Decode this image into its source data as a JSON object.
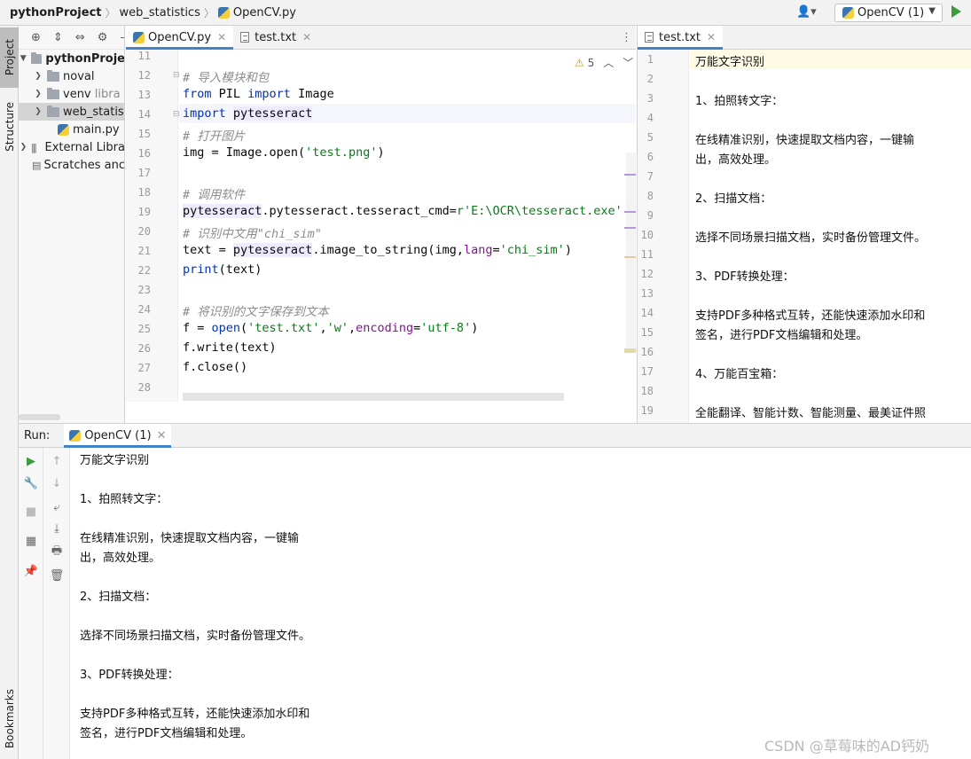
{
  "breadcrumb": {
    "project": "pythonProject",
    "folder": "web_statistics",
    "file": "OpenCV.py"
  },
  "toolbar": {
    "run_config": "OpenCV (1)"
  },
  "side_tabs": {
    "project": "Project",
    "structure": "Structure",
    "bookmarks": "Bookmarks"
  },
  "project_tree": {
    "root": "pythonProje",
    "items": [
      "noval",
      "venv",
      "libra",
      "web_statis",
      "main.py",
      "External Libra",
      "Scratches anc"
    ]
  },
  "editor_tabs": {
    "main": "OpenCV.py",
    "secondary": "test.txt",
    "right": "test.txt"
  },
  "inspection": {
    "warning_count": "5"
  },
  "code": {
    "line_numbers": [
      "11",
      "12",
      "13",
      "14",
      "15",
      "16",
      "17",
      "18",
      "19",
      "20",
      "21",
      "22",
      "23",
      "24",
      "25",
      "26",
      "27",
      "28"
    ],
    "c12": "# 导入模块和包",
    "l13a": "from",
    "l13b": " PIL ",
    "l13c": "import",
    "l13d": " Image",
    "l14a": "import",
    "l14b": "pytesseract",
    "c15": "# 打开图片",
    "l16a": "img = Image.open(",
    "l16b": "'test.png'",
    "l16c": ")",
    "c18": "# 调用软件",
    "l19a": "pytesseract",
    "l19b": ".pytesseract.tesseract_cmd=",
    "l19c": "r'E:\\OCR\\tesseract.exe'",
    "c20": "# 识别中文用\"chi_sim\"",
    "l21a": "text = ",
    "l21b": "pytesseract",
    "l21c": ".image_to_string(img,",
    "l21d": "lang",
    "l21e": "=",
    "l21f": "'chi_sim'",
    "l21g": ")",
    "l22a": "print",
    "l22b": "(text)",
    "c24": "# 将识别的文字保存到文本",
    "l25a": "f = ",
    "l25b": "open",
    "l25c": "(",
    "l25d": "'test.txt'",
    "l25e": ",",
    "l25f": "'w'",
    "l25g": ",",
    "l25h": "encoding",
    "l25i": "=",
    "l25j": "'utf-8'",
    "l25k": ")",
    "l26": "f.write(text)",
    "l27": "f.close()"
  },
  "text_file": {
    "line_numbers": [
      "1",
      "2",
      "3",
      "4",
      "5",
      "6",
      "7",
      "8",
      "9",
      "10",
      "11",
      "12",
      "13",
      "14",
      "15",
      "16",
      "17",
      "18",
      "19"
    ],
    "lines": [
      "万能文字识别",
      "",
      "1、拍照转文字：",
      "",
      "在线精准识别，快速提取文档内容，一键输",
      "出，高效处理。",
      "",
      "2、扫描文档：",
      "",
      "选择不同场景扫描文档，实时备份管理文件。",
      "",
      "3、PDF转换处理：",
      "",
      "支持PDF多种格式互转，还能快速添加水印和",
      "签名，进行PDF文档编辑和处理。",
      "",
      "4、万能百宝箱：",
      "",
      "全能翻译、智能计数、智能测量、最美证件照"
    ]
  },
  "run": {
    "label": "Run:",
    "tab": "OpenCV (1)",
    "output": [
      "万能文字识别",
      "",
      "1、拍照转文字：",
      "",
      "在线精准识别，快速提取文档内容，一键输",
      "出，高效处理。",
      "",
      "2、扫描文档：",
      "",
      "选择不同场景扫描文档，实时备份管理文件。",
      "",
      "3、PDF转换处理：",
      "",
      "支持PDF多种格式互转，还能快速添加水印和",
      "签名，进行PDF文档编辑和处理。"
    ]
  },
  "watermark": "CSDN @草莓味的AD钙奶",
  "colors": {
    "keyword": "#0033b3",
    "comment": "#8c8c8c",
    "string": "#067d17",
    "param": "#871094",
    "accent": "#4083c9",
    "run_green": "#3d9a3d"
  }
}
